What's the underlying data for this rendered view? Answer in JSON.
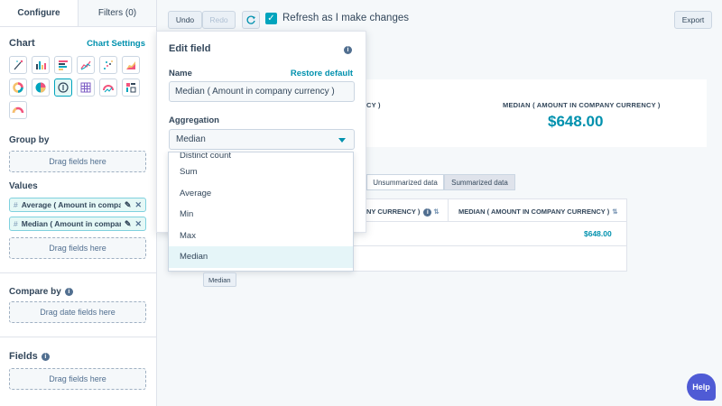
{
  "tabs": {
    "configure": "Configure",
    "filters": "Filters (0)"
  },
  "chart_section": {
    "title": "Chart",
    "settings_link": "Chart Settings",
    "types": [
      "magic",
      "bar",
      "horizontal-bar",
      "line",
      "scatter",
      "area",
      "donut",
      "pie",
      "kpi",
      "table",
      "gauge",
      "pivot",
      "arc"
    ]
  },
  "group_by": {
    "title": "Group by",
    "drop": "Drag fields here"
  },
  "values": {
    "title": "Values",
    "hash": "#",
    "pills": [
      {
        "label": "Average ( Amount in compan..."
      },
      {
        "label": "Median ( Amount in compan..."
      }
    ],
    "drop": "Drag fields here"
  },
  "compare_by": {
    "title": "Compare by",
    "drop": "Drag date fields here"
  },
  "fields": {
    "title": "Fields",
    "drop": "Drag fields here"
  },
  "toolbar": {
    "undo": "Undo",
    "redo": "Redo",
    "refresh_label": "Refresh as I make changes",
    "export": "Export"
  },
  "kpi": {
    "left_label_partial": "CY )",
    "right_label": "MEDIAN ( AMOUNT IN COMPANY CURRENCY )",
    "right_value": "$648.00"
  },
  "data_toggle": {
    "unsummarized": "Unsummarized data",
    "summarized": "Summarized data"
  },
  "table": {
    "col1_partial": "NY CURRENCY )",
    "col2": "MEDIAN ( AMOUNT IN COMPANY CURRENCY )",
    "row_value": "$648.00"
  },
  "edit_field": {
    "title": "Edit field",
    "name_label": "Name",
    "restore": "Restore default",
    "name_value": "Median ( Amount in company currency )",
    "aggregation_label": "Aggregation",
    "aggregation_value": "Median",
    "options": [
      "Distinct count",
      "Sum",
      "Average",
      "Min",
      "Max",
      "Median"
    ]
  },
  "tooltip": "Median",
  "help": "Help"
}
